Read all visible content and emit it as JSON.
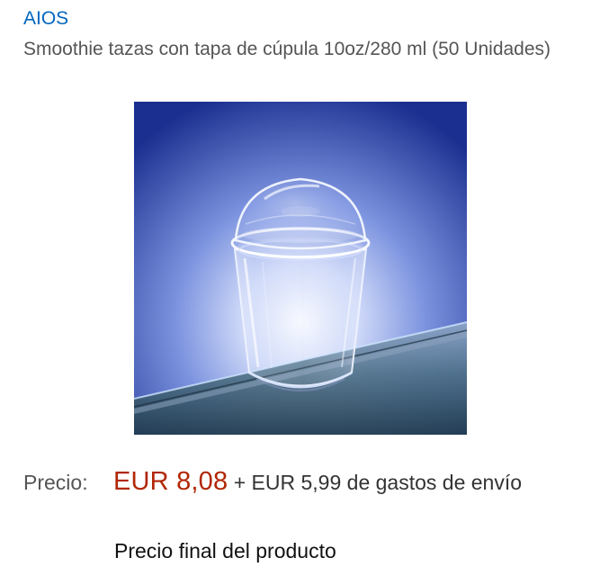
{
  "product": {
    "brand": "AIOS",
    "title": "Smoothie tazas con tapa de cúpula 10oz/280 ml (50 Unidades)",
    "image_name": "clear-plastic-cup-with-dome-lid"
  },
  "price": {
    "label": "Precio:",
    "amount": "EUR 8,08",
    "shipping": "+ EUR 5,99 de gastos de envío",
    "final_note": "Precio final del producto"
  }
}
